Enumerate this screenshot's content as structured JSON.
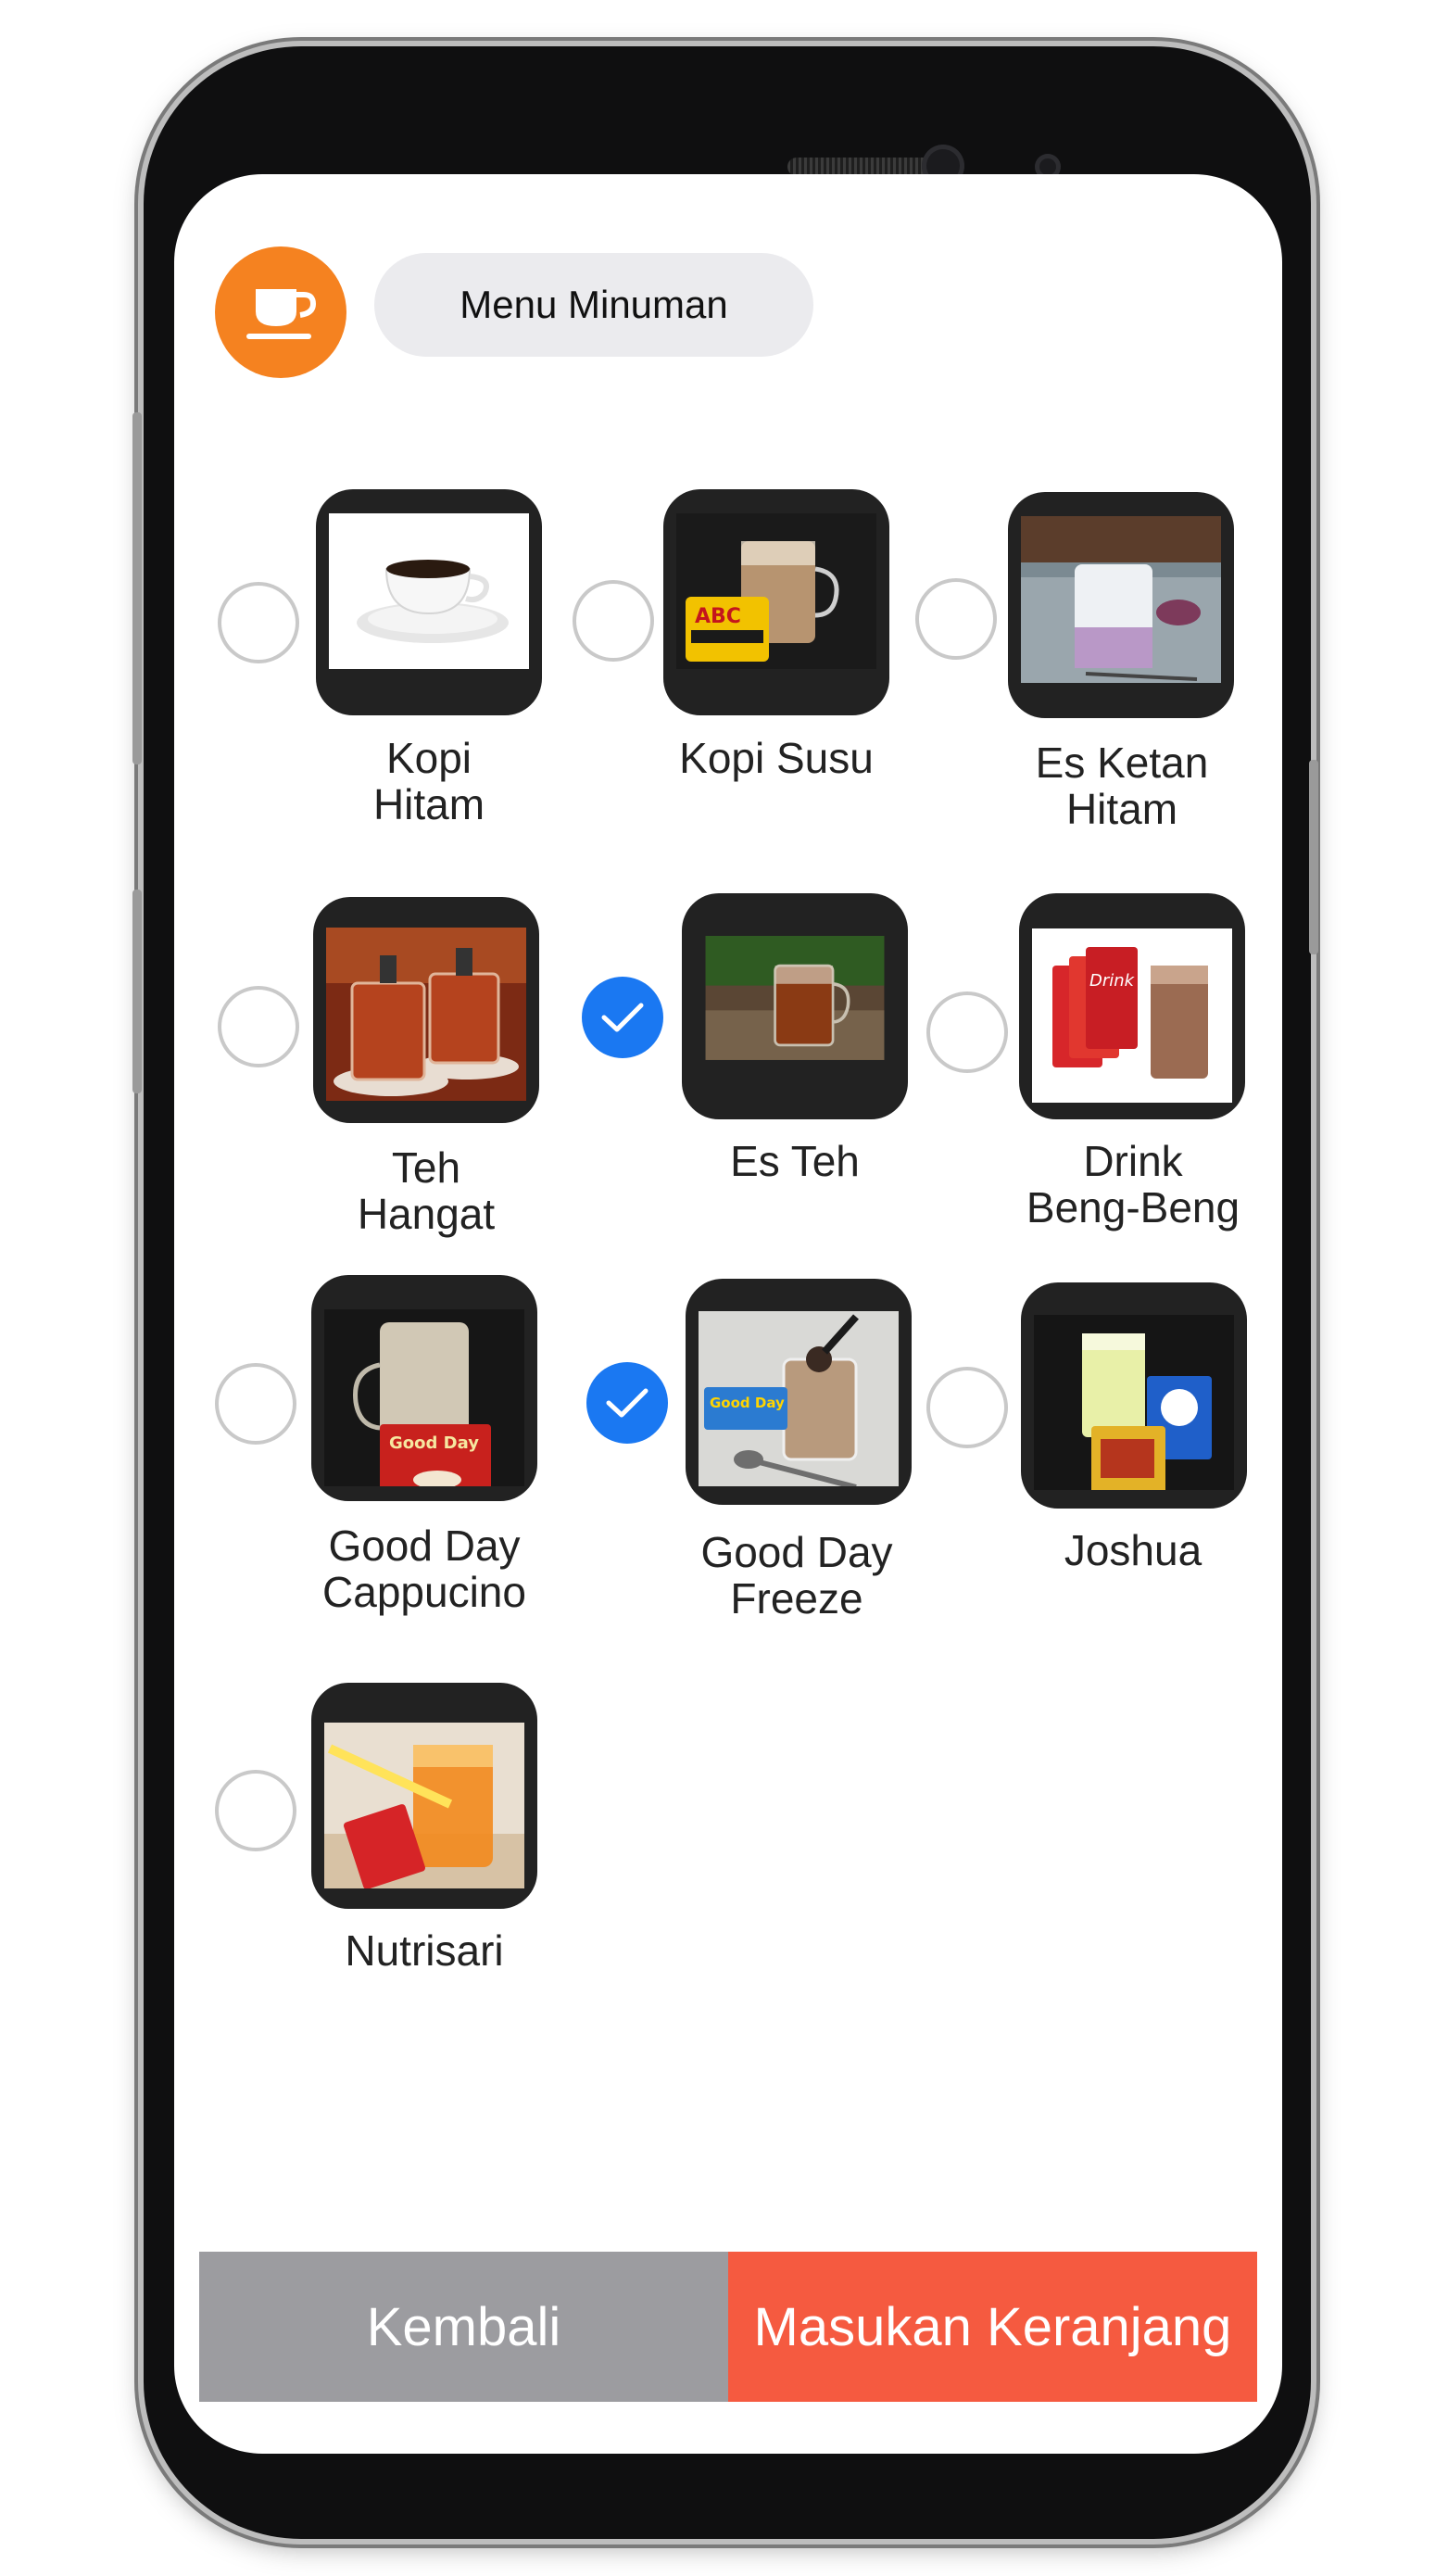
{
  "header": {
    "category_icon": "coffee-cup-icon",
    "category_label": "Menu Minuman"
  },
  "menu_items": [
    {
      "label": "Kopi\nHitam",
      "selected": false
    },
    {
      "label": "Kopi Susu",
      "selected": false
    },
    {
      "label": "Es Ketan\nHitam",
      "selected": false
    },
    {
      "label": "Teh\nHangat",
      "selected": false
    },
    {
      "label": "Es Teh",
      "selected": true
    },
    {
      "label": "Drink\nBeng-Beng",
      "selected": false
    },
    {
      "label": "Good Day\nCappucino",
      "selected": false
    },
    {
      "label": "Good Day\nFreeze",
      "selected": true
    },
    {
      "label": "Joshua",
      "selected": false
    },
    {
      "label": "Nutrisari",
      "selected": false
    }
  ],
  "footer": {
    "back_label": "Kembali",
    "cart_label": "Masukan Keranjang"
  },
  "colors": {
    "accent_orange": "#f58220",
    "selected_blue": "#1a78f2",
    "cart_red": "#f55a40",
    "back_gray": "#9c9ca0"
  }
}
